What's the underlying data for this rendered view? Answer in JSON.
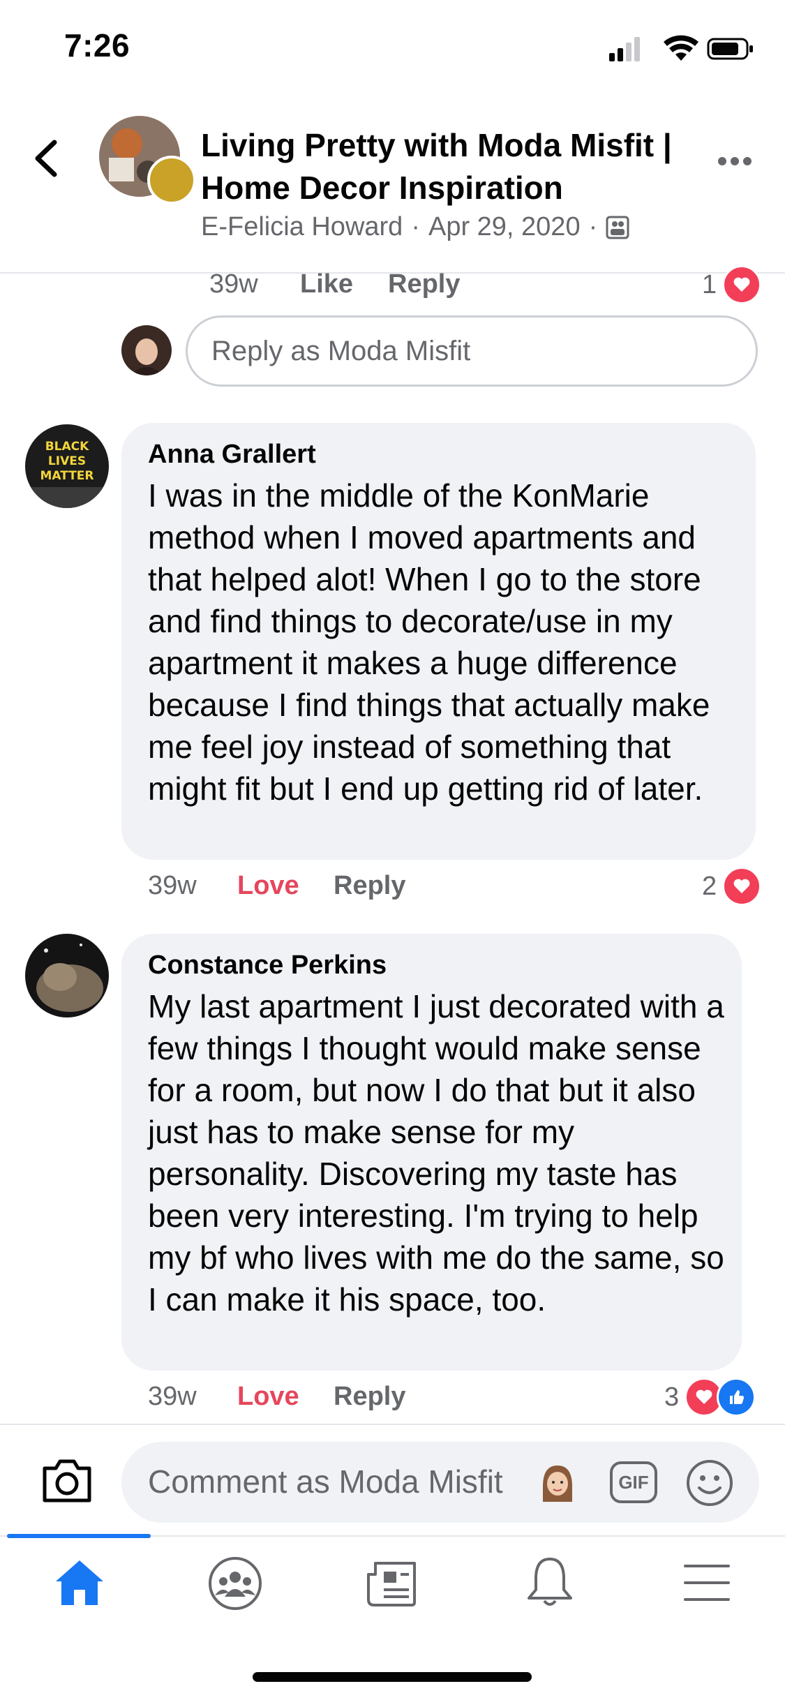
{
  "status_bar": {
    "time": "7:26"
  },
  "header": {
    "group_title": "Living Pretty with Moda Misfit | Home Decor Inspiration",
    "author": "E-Felicia Howard",
    "date": "Apr 29, 2020",
    "separator": "·"
  },
  "prev_reply": {
    "age": "39w",
    "like_label": "Like",
    "reply_label": "Reply",
    "reaction_count": "1"
  },
  "reply_input": {
    "placeholder": "Reply as Moda Misfit"
  },
  "comments": [
    {
      "name": "Anna Grallert",
      "avatar_text": "BLACK LIVES MATTER",
      "text": "I was in the middle of the KonMarie method when I moved apartments and that helped alot! When I go to the store and find things to decorate/use in my apartment it makes a huge difference because I find things that actually make me feel joy instead of something that might fit but I end up getting rid of later.",
      "age": "39w",
      "reaction_label": "Love",
      "reply_label": "Reply",
      "reaction_count": "2"
    },
    {
      "name": "Constance Perkins",
      "text": "My last apartment I just decorated with a few things I thought would make sense for a room, but now I do that but it also just has to make sense for my personality. Discovering my taste has been very interesting. I'm trying to help my bf who lives with me do the same, so I can make it his space, too.",
      "age": "39w",
      "reaction_label": "Love",
      "reply_label": "Reply",
      "reaction_count": "3"
    }
  ],
  "composer": {
    "placeholder": "Comment as Moda Misfit",
    "gif_label": "GIF"
  },
  "tabbar": {
    "items": [
      "home-icon",
      "groups-icon",
      "news-icon",
      "bell-icon",
      "menu-icon"
    ],
    "active": "home-icon"
  },
  "colors": {
    "accent": "#1877f2",
    "love": "#e4475c",
    "heart": "#f33e58",
    "bubble": "#f0f2f5",
    "muted": "#65676b"
  }
}
